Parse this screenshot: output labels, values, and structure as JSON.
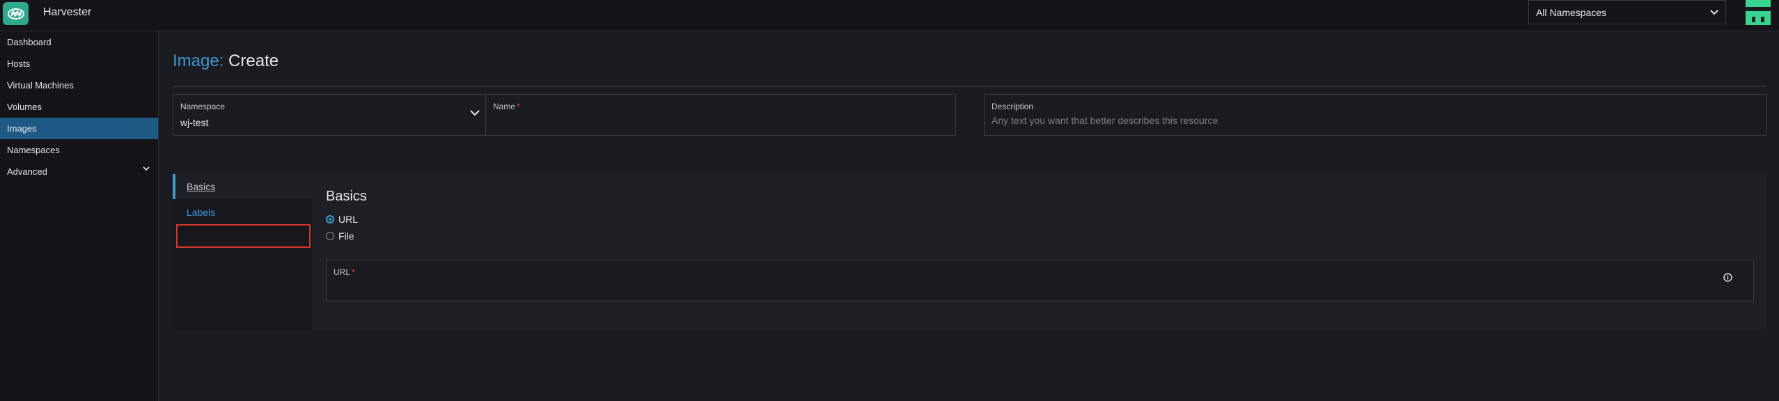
{
  "header": {
    "app_name": "Harvester",
    "namespace_filter": "All Namespaces"
  },
  "sidebar": {
    "items": [
      {
        "label": "Dashboard"
      },
      {
        "label": "Hosts"
      },
      {
        "label": "Virtual Machines"
      },
      {
        "label": "Volumes"
      },
      {
        "label": "Images"
      },
      {
        "label": "Namespaces"
      },
      {
        "label": "Advanced"
      }
    ],
    "active": "Images"
  },
  "page": {
    "crumb": "Image:",
    "title": "Create"
  },
  "form": {
    "namespace_label": "Namespace",
    "namespace_value": "wj-test",
    "name_label": "Name",
    "name_required": "*",
    "description_label": "Description",
    "description_placeholder": "Any text you want that better describes this resource"
  },
  "tabs": {
    "basics": "Basics",
    "labels": "Labels"
  },
  "basics": {
    "title": "Basics",
    "source_options": [
      {
        "label": "URL",
        "selected": true
      },
      {
        "label": "File",
        "selected": false
      }
    ],
    "url_label": "URL",
    "url_required": "*"
  },
  "colors": {
    "accent": "#3d98d3",
    "active_nav": "#1f5a86",
    "brand": "#2fa88c",
    "required": "#e04a3c",
    "highlight": "#d8352a"
  }
}
